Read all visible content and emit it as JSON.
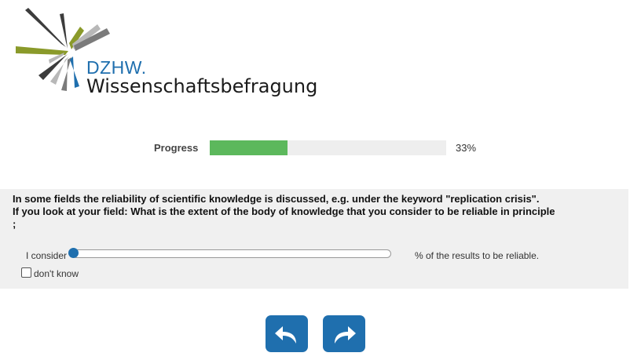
{
  "logo": {
    "brand": "DZHW.",
    "name": "Wissenschaftsbefragung",
    "colors": [
      "#3c3c3c",
      "#7b7b7b",
      "#b8b8b8",
      "#8a9a2a",
      "#1f6fae"
    ]
  },
  "progress": {
    "label": "Progress",
    "percent": 33,
    "value_text": "33%",
    "fill_color": "#5cb85c"
  },
  "question": {
    "line1": "In some fields the reliability of scientific knowledge is discussed, e.g. under the keyword \"replication crisis\".",
    "line2": "If you look at your field: What is the extent of the body of knowledge that you consider to be reliable in principle",
    "line3": ";"
  },
  "slider": {
    "prefix": "I consider",
    "suffix": "% of the results to be reliable.",
    "value": 0,
    "min": 0,
    "max": 100
  },
  "dont_know": {
    "label": "don't know",
    "checked": false
  },
  "nav": {
    "back_icon": "back-arrow-icon",
    "next_icon": "forward-arrow-icon",
    "button_color": "#1f6fae"
  }
}
